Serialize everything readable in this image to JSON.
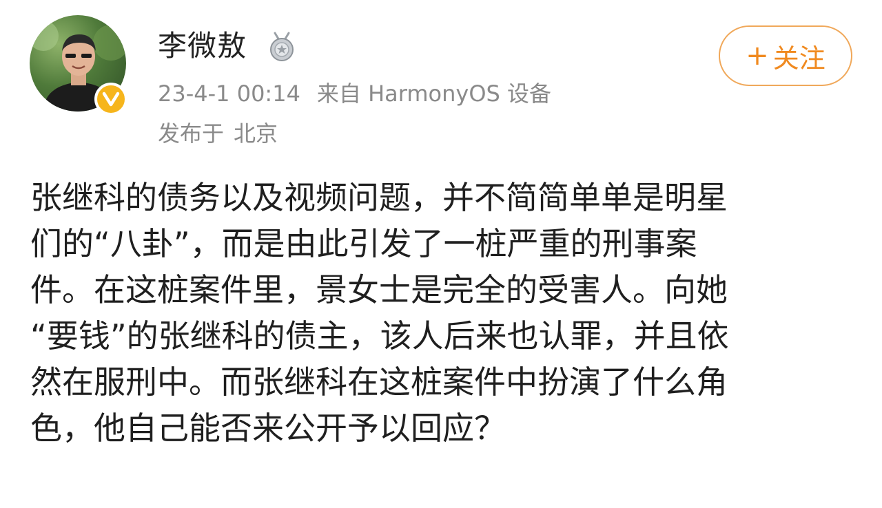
{
  "user": {
    "name": "李微敖",
    "avatar_icon": "user-avatar-photo",
    "badge_icon": "verified-v-badge",
    "medal_icon": "silver-medal-icon"
  },
  "meta": {
    "time": "23-4-1 00:14",
    "source": "来自 HarmonyOS 设备",
    "location_prefix": "发布于",
    "location": "北京"
  },
  "follow_button": {
    "plus": "+",
    "label": "关注",
    "color": "#f08a20"
  },
  "post": {
    "lines": [
      "张继科的债务以及视频问题，并不简简单单是明星",
      "们的“八卦”，而是由此引发了一桩严重的刑事案",
      "件。在这桩案件里，景女士是完全的受害人。向她",
      "“要钱”的张继科的债主，该人后来也认罪，并且依",
      "然在服刑中。而张继科在这桩案件中扮演了什么角",
      "色，他自己能否来公开予以回应？"
    ]
  }
}
